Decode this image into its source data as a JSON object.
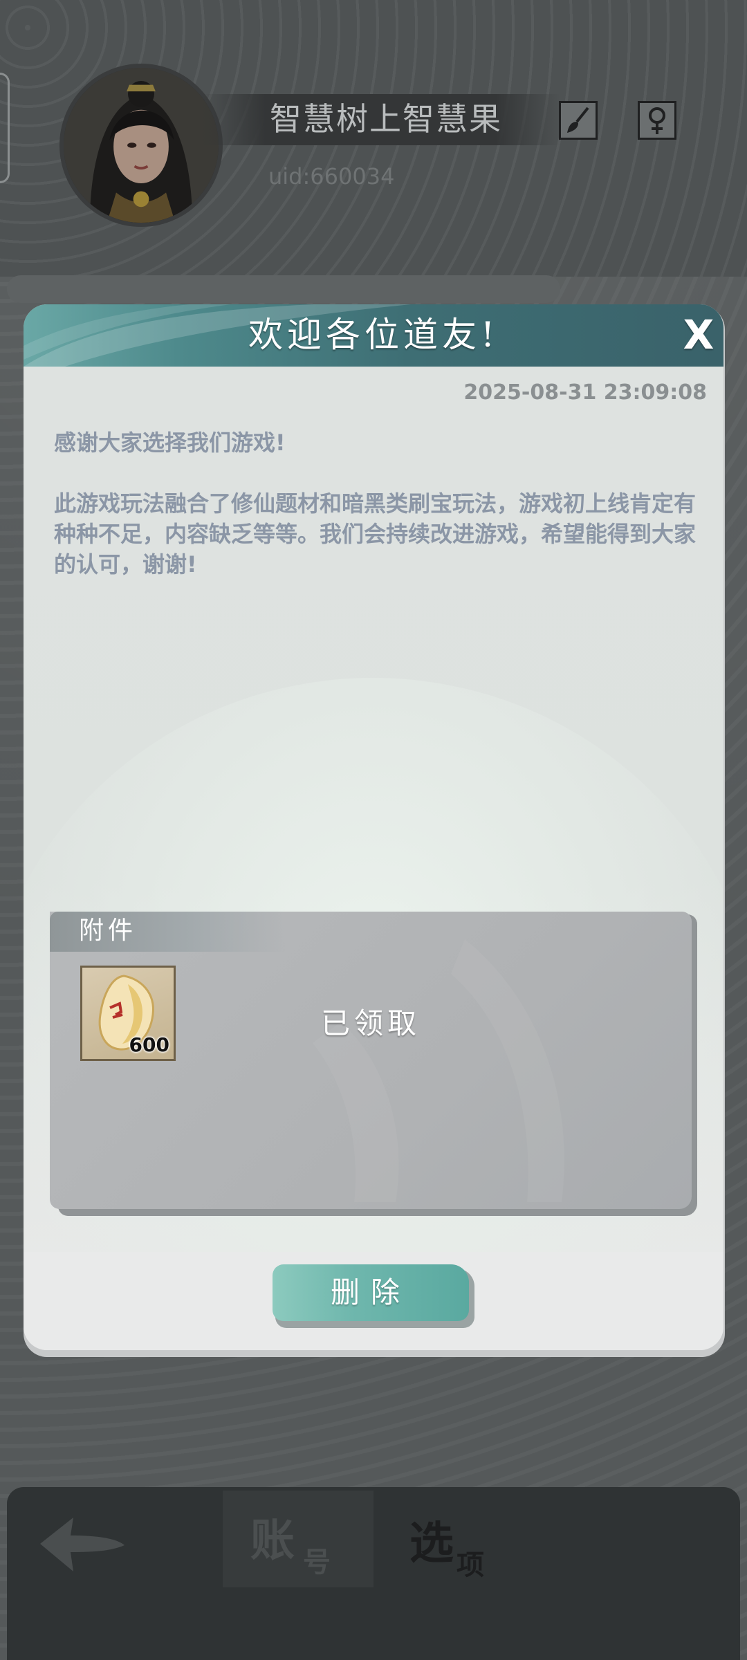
{
  "profile": {
    "name": "智慧树上智慧果",
    "uid": "uid:660034"
  },
  "icons": {
    "brush": "brush-icon",
    "gender": "female-symbol-icon",
    "back": "back-arrow-icon",
    "close": "close-icon"
  },
  "mail": {
    "title": "欢迎各位道友!",
    "close_label": "X",
    "date": "2025-08-31 23:09:08",
    "paragraph_1": "感谢大家选择我们游戏!",
    "paragraph_2": "此游戏玩法融合了修仙题材和暗黑类刷宝玩法，游戏初上线肯定有种种不足，内容缺乏等等。我们会持续改进游戏，希望能得到大家的认可，谢谢!",
    "attachments_label": "附件",
    "attachment_items": [
      {
        "icon": "spirit-stone-icon",
        "count": "600"
      }
    ],
    "claimed_label": "已领取",
    "delete_label": "删除"
  },
  "bottom_tabs": {
    "account_big": "账",
    "account_small": "号",
    "options_big": "选",
    "options_small": "项"
  },
  "colors": {
    "header_teal": "#3e6e74",
    "button_teal": "#6fb7ad",
    "body_text": "#8b96a6"
  }
}
